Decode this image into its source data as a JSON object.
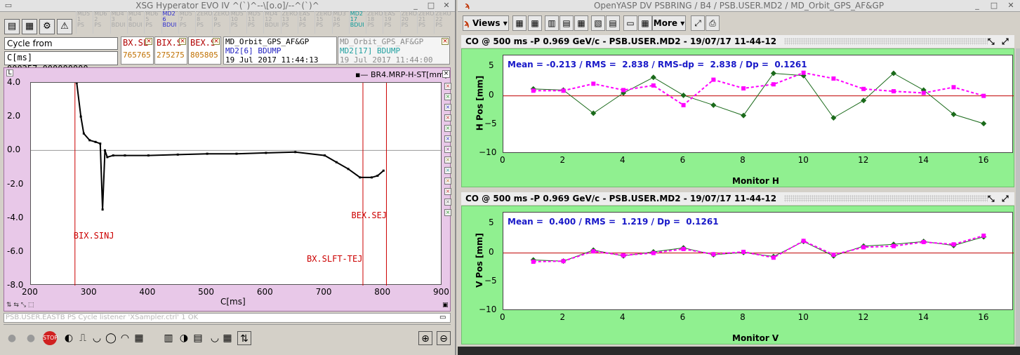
{
  "left_window": {
    "title": "XSG Hyperator EVO IV  ^(`)^--\\[o.o]/--^(`)^",
    "user_cells": [
      {
        "label": "MD5 1 PS"
      },
      {
        "label": "MD6 2 PS"
      },
      {
        "label": "MD4 3 BDUI"
      },
      {
        "label": "MD4 4 BDUI"
      },
      {
        "label": "MD6 5 PS"
      },
      {
        "label": "MD2 6 BDUI"
      },
      {
        "label": "MD5 7 PS"
      },
      {
        "label": "ZERO 8 PS"
      },
      {
        "label": "ZERO 9 PS"
      },
      {
        "label": "MD5 10 PS"
      },
      {
        "label": "MD5 11 PS"
      },
      {
        "label": "MD4 12 BDUI"
      },
      {
        "label": "ZERO 13 PS"
      },
      {
        "label": "EAS 14 PS"
      },
      {
        "label": "ZERO 15 PS"
      },
      {
        "label": "MD3 16 PS"
      },
      {
        "label": "MD2 17 BDUI"
      },
      {
        "label": "ZERO 18 PS"
      },
      {
        "label": "EAS 19 PS"
      },
      {
        "label": "ZERO 20 PS"
      },
      {
        "label": "ZERO 21 PS"
      },
      {
        "label": "ZERO 22 PS"
      }
    ],
    "cycle_from": "Cycle from",
    "cycle_value": "C[ms] 000257.000000000",
    "events": [
      {
        "name": "BX.SL",
        "v1": "765",
        "v2": "765"
      },
      {
        "name": "BIX.S",
        "v1": "275",
        "v2": "275"
      },
      {
        "name": "BEX.S",
        "v1": "805",
        "v2": "805"
      }
    ],
    "info_a": {
      "name": "MD_Orbit_GPS_AF&GP",
      "user": "MD2[6] BDUMP",
      "time": "19 Jul 2017 11:44:13"
    },
    "info_b": {
      "name": "MD_Orbit_GPS_AF&GP",
      "user": "MD2[17] BDUMP",
      "time": "19 Jul 2017 11:44:00"
    },
    "plot": {
      "legend": "BR4.MRP-H-ST[mm]",
      "xlabel": "C[ms]",
      "xticks": [
        "200",
        "300",
        "400",
        "500",
        "600",
        "700",
        "800",
        "900"
      ],
      "yticks": [
        "4.0",
        "2.0",
        "0.0",
        "-2.0",
        "-4.0",
        "-6.0",
        "-8.0"
      ],
      "markers": [
        {
          "label": "BIX.SINJ",
          "x": 275
        },
        {
          "label": "BX.SLFT-TEJ",
          "x": 765
        },
        {
          "label": "BEX.SEJ",
          "x": 805
        }
      ],
      "corner_top": "L"
    },
    "status": "PSB.USER.EASTB PS Cycle listener 'XSampler.ctrl' 1 OK"
  },
  "right_window": {
    "title": "OpenYASP DV PSBRING / B4 / PSB.USER.MD2 / MD_Orbit_GPS_AF&GP",
    "views_label": "Views",
    "more_label": "More",
    "panels": [
      {
        "header": "CO @ 500 ms -P   0.969 GeV/c - PSB.USER.MD2 - 19/07/17 11-44-12",
        "stats": "Mean = -0.213 / RMS =  2.838 / RMS-dp =  2.838 / Dp =  0.1261",
        "ylabel": "H Pos [mm]",
        "xlabel": "Monitor H",
        "yticks": [
          "5",
          "0",
          "−5",
          "−10"
        ],
        "xticks": [
          "0",
          "2",
          "4",
          "6",
          "8",
          "10",
          "12",
          "14",
          "16"
        ]
      },
      {
        "header": "CO @ 500 ms -P   0.969 GeV/c - PSB.USER.MD2 - 19/07/17 11-44-12",
        "stats": "Mean =  0.400 / RMS =  1.219 / Dp =  0.1261",
        "ylabel": "V Pos [mm]",
        "xlabel": "Monitor V",
        "yticks": [
          "5",
          "0",
          "−5",
          "−10"
        ],
        "xticks": [
          "0",
          "2",
          "4",
          "6",
          "8",
          "10",
          "12",
          "14",
          "16"
        ]
      }
    ]
  },
  "chart_data": [
    {
      "type": "line",
      "xlabel": "C[ms]",
      "ylabel": "",
      "xlim": [
        200,
        900
      ],
      "ylim": [
        -8,
        4
      ],
      "series": [
        {
          "name": "BR4.MRP-H-ST[mm]",
          "x": [
            278,
            285,
            290,
            300,
            310,
            318,
            322,
            326,
            330,
            340,
            360,
            400,
            450,
            500,
            550,
            600,
            650,
            700,
            720,
            740,
            760,
            780,
            790,
            800
          ],
          "y": [
            4.0,
            2.0,
            1.0,
            0.6,
            0.5,
            0.4,
            -3.5,
            0.0,
            -0.4,
            -0.3,
            -0.3,
            -0.3,
            -0.25,
            -0.2,
            -0.2,
            -0.15,
            -0.1,
            -0.3,
            -0.7,
            -1.1,
            -1.6,
            -1.6,
            -1.5,
            -1.2
          ]
        }
      ],
      "colors": {
        "series": "#000000",
        "markers": "#cc0000"
      }
    },
    {
      "type": "line",
      "xlabel": "Monitor H",
      "ylabel": "H Pos [mm]",
      "xlim": [
        0,
        17
      ],
      "ylim": [
        -10,
        7
      ],
      "x": [
        1,
        2,
        3,
        4,
        5,
        6,
        7,
        8,
        9,
        10,
        11,
        12,
        13,
        14,
        15,
        16
      ],
      "series": [
        {
          "values": [
            1.2,
            1.0,
            -3.0,
            0.5,
            3.2,
            0.1,
            -1.6,
            -3.4,
            3.9,
            3.5,
            -3.8,
            -0.8,
            3.9,
            1.0,
            -3.2,
            -4.8
          ],
          "color": "#1a6a1a"
        },
        {
          "values": [
            0.9,
            0.9,
            2.1,
            1.0,
            1.8,
            -1.6,
            2.8,
            1.3,
            2.0,
            4.0,
            3.0,
            1.2,
            0.8,
            0.5,
            1.5,
            0.0
          ],
          "color": "#ff00ff"
        }
      ]
    },
    {
      "type": "line",
      "xlabel": "Monitor V",
      "ylabel": "V Pos [mm]",
      "xlim": [
        0,
        17
      ],
      "ylim": [
        -10,
        7
      ],
      "x": [
        1,
        2,
        3,
        4,
        5,
        6,
        7,
        8,
        9,
        10,
        11,
        12,
        13,
        14,
        15,
        16
      ],
      "series": [
        {
          "values": [
            -1.2,
            -1.4,
            0.5,
            -0.5,
            0.2,
            0.9,
            -0.3,
            0.1,
            -0.6,
            2.0,
            -0.5,
            1.2,
            1.5,
            2.0,
            1.3,
            2.8
          ],
          "color": "#1a6a1a"
        },
        {
          "values": [
            -1.5,
            -1.4,
            0.3,
            -0.4,
            0.0,
            0.7,
            -0.2,
            0.2,
            -0.8,
            2.1,
            -0.3,
            1.0,
            1.2,
            1.9,
            1.5,
            3.0
          ],
          "color": "#ff00ff"
        }
      ]
    }
  ]
}
